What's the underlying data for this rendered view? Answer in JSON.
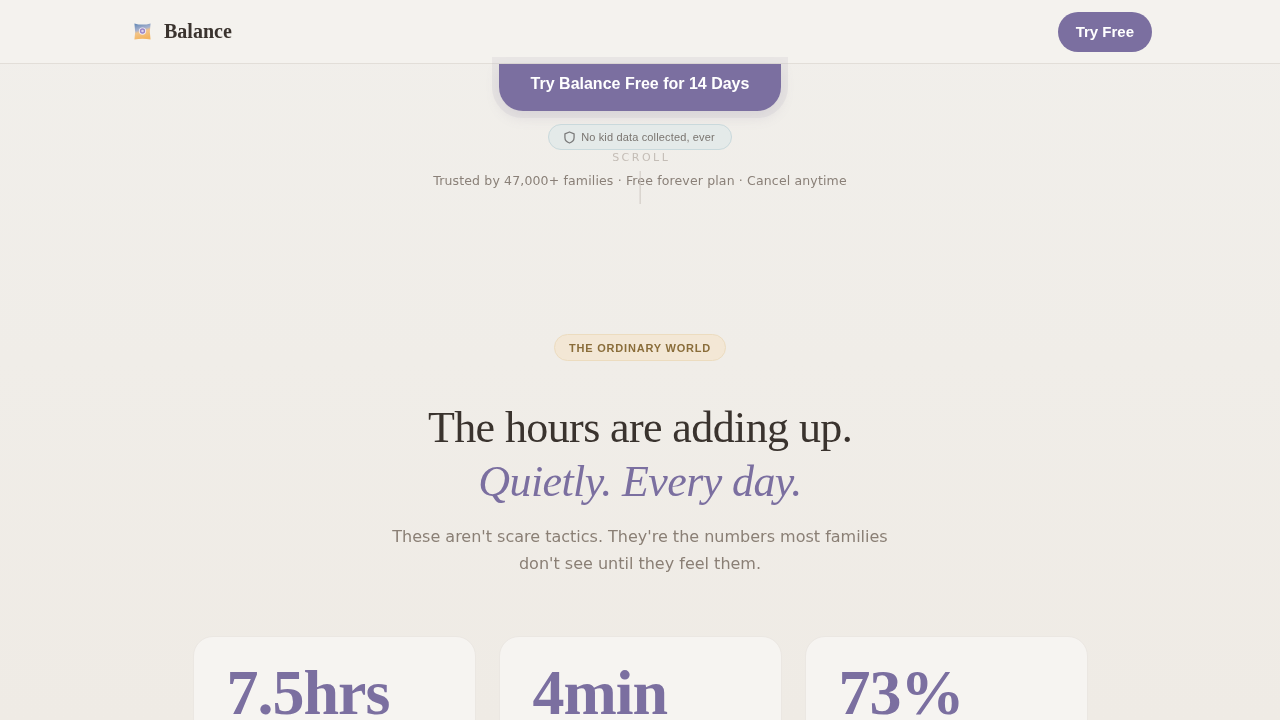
{
  "header": {
    "brand": "Balance",
    "button": "Try Free"
  },
  "hero": {
    "cta": "Try Balance Free for 14 Days",
    "privacy_badge": "No kid data collected, ever",
    "scroll_hint": "SCROLL",
    "trust_line": "Trusted by 47,000+ families · Free forever plan · Cancel anytime"
  },
  "section": {
    "eyebrow": "THE ORDINARY WORLD",
    "heading": "The hours are adding up.",
    "heading_accent": "Quietly. Every day.",
    "intro": "These aren't scare tactics. They're the numbers most families don't see until they feel them.",
    "stats": [
      {
        "value": "7.5hrs"
      },
      {
        "value": "4min"
      },
      {
        "value": "73%"
      }
    ]
  }
}
